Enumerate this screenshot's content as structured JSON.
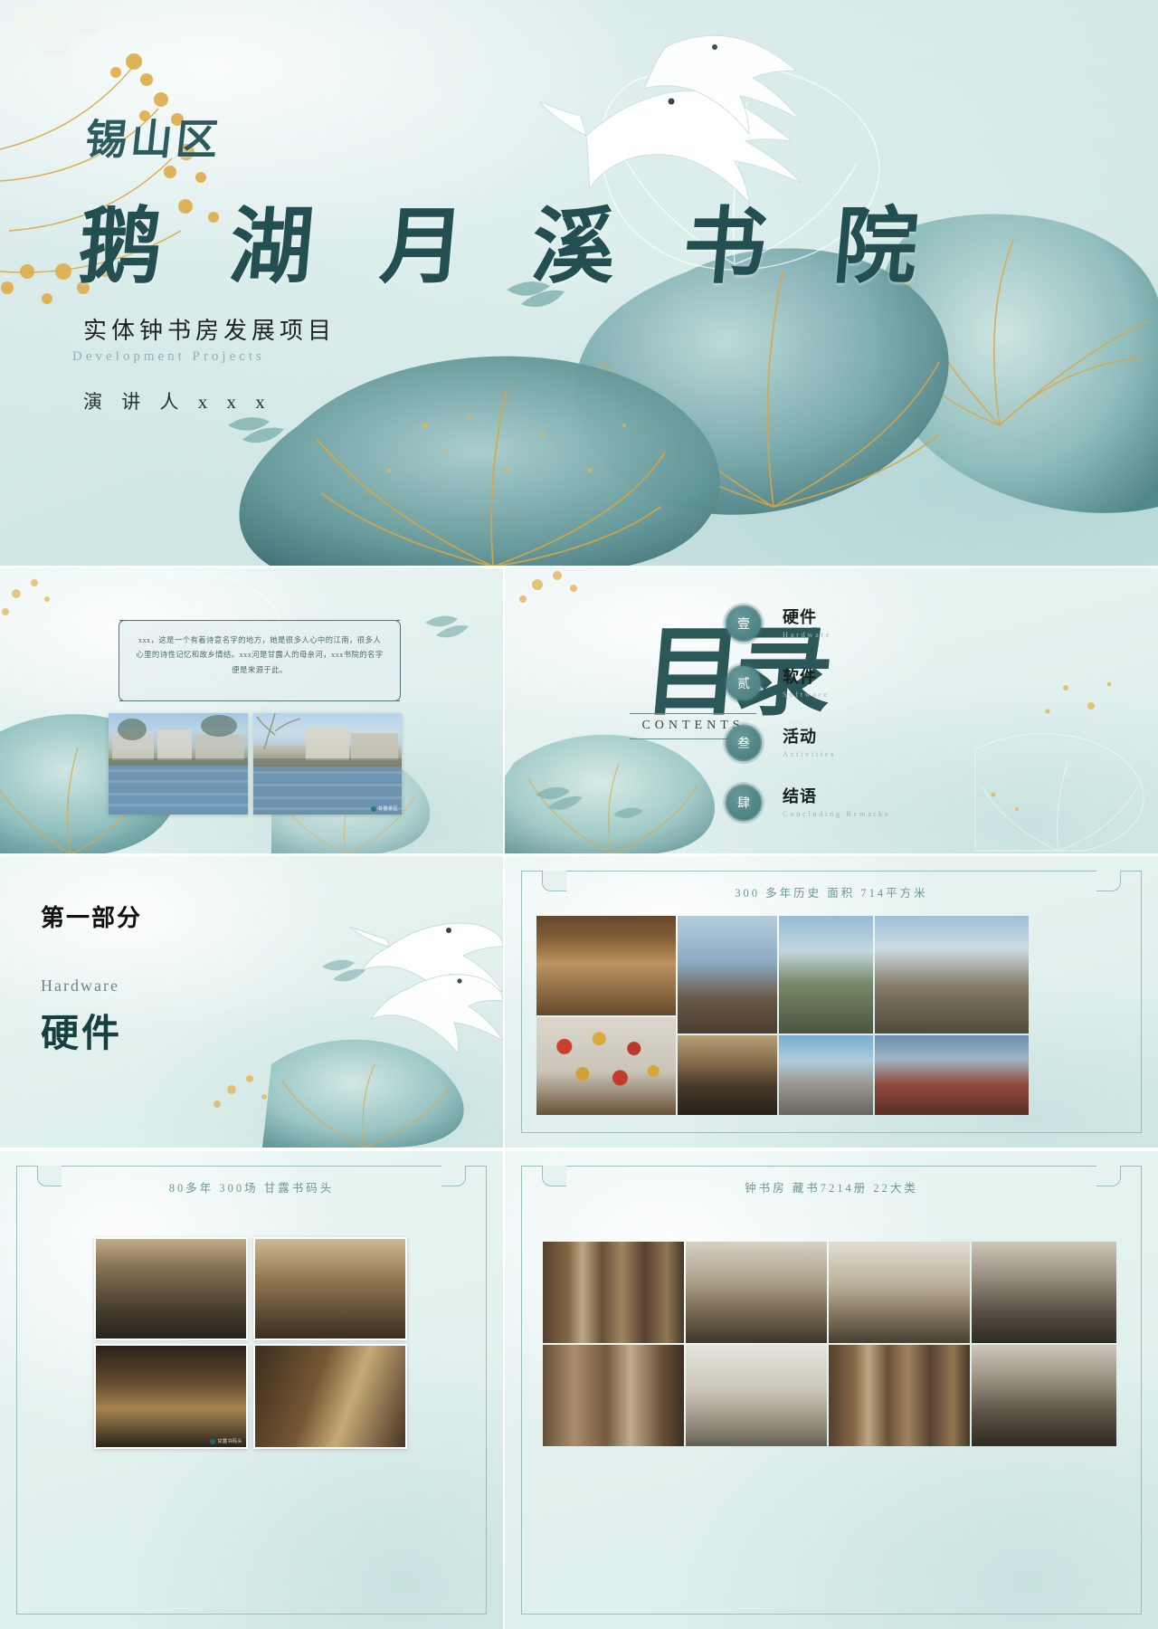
{
  "cover": {
    "district": "锡山区",
    "title": "鹅 湖 月 溪 书 院",
    "subtitle_cn": "实体钟书房发展项目",
    "subtitle_en": "Development  Projects",
    "speaker": "演 讲 人  x x x"
  },
  "intro": {
    "paragraph": "xxx，这是一个有着诗意名字的地方，她是很多人心中的江南，很多人心里的诗性记忆和故乡情结。xxx河是甘露人的母亲河，xxx书院的名字便是来源于此。",
    "photos": [
      {
        "name": "canal-waterfront-photo",
        "badge": "甘露景区"
      },
      {
        "name": "canal-bridge-photo",
        "badge": ""
      }
    ]
  },
  "contents": {
    "heading_cn": "目录",
    "heading_en": "CONTENTS",
    "items": [
      {
        "num": "壹",
        "cn": "硬件",
        "en": "Hardware"
      },
      {
        "num": "贰",
        "cn": "软件",
        "en": "Software"
      },
      {
        "num": "叁",
        "cn": "活动",
        "en": "Activities"
      },
      {
        "num": "肆",
        "cn": "结语",
        "en": "Concluding Remarks"
      }
    ]
  },
  "section": {
    "part": "第一部分",
    "en": "Hardware",
    "cn": "硬件"
  },
  "gallery_a": {
    "heading": "300 多年历史   面积 714平方米"
  },
  "gallery_b": {
    "heading": "80多年  300场  甘露书码头"
  },
  "gallery_c": {
    "heading": "钟书房   藏书7214册   22大类"
  },
  "colors": {
    "brand_teal": "#2c5759",
    "deep_ink": "#16403f",
    "muted_teal": "#6e9596",
    "gold": "#d9a441",
    "paper": "#e2eeee"
  }
}
